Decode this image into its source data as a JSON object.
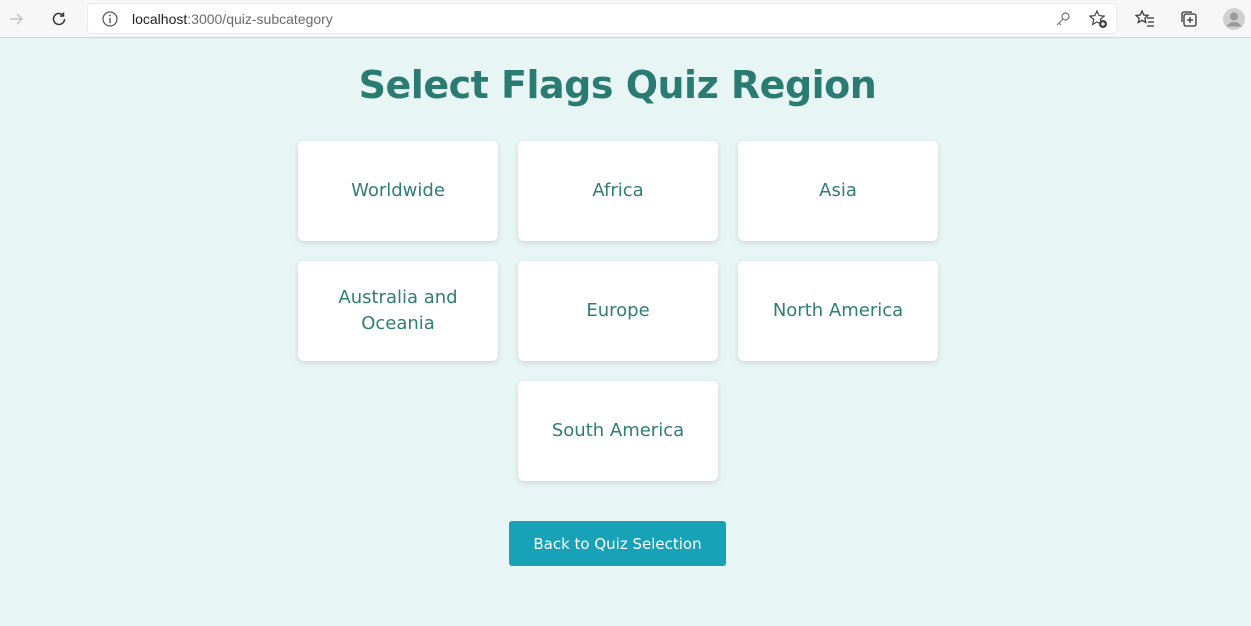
{
  "browser": {
    "url_host": "localhost",
    "url_path": ":3000/quiz-subcategory",
    "icons": [
      "back-icon",
      "reload-icon",
      "info-icon",
      "key-icon",
      "favorite-add-icon",
      "favorites-icon",
      "collections-icon",
      "profile-icon"
    ]
  },
  "page": {
    "title": "Select Flags Quiz Region",
    "regions": [
      {
        "label": "Worldwide"
      },
      {
        "label": "Africa"
      },
      {
        "label": "Asia"
      },
      {
        "label": "Australia and Oceania"
      },
      {
        "label": "Europe"
      },
      {
        "label": "North America"
      },
      {
        "label": "South America"
      }
    ],
    "back_button": "Back to Quiz Selection"
  },
  "colors": {
    "background": "#e8f5f5",
    "title": "#2a7b72",
    "card_text": "#2f7d75",
    "button": "#17a2b8"
  }
}
